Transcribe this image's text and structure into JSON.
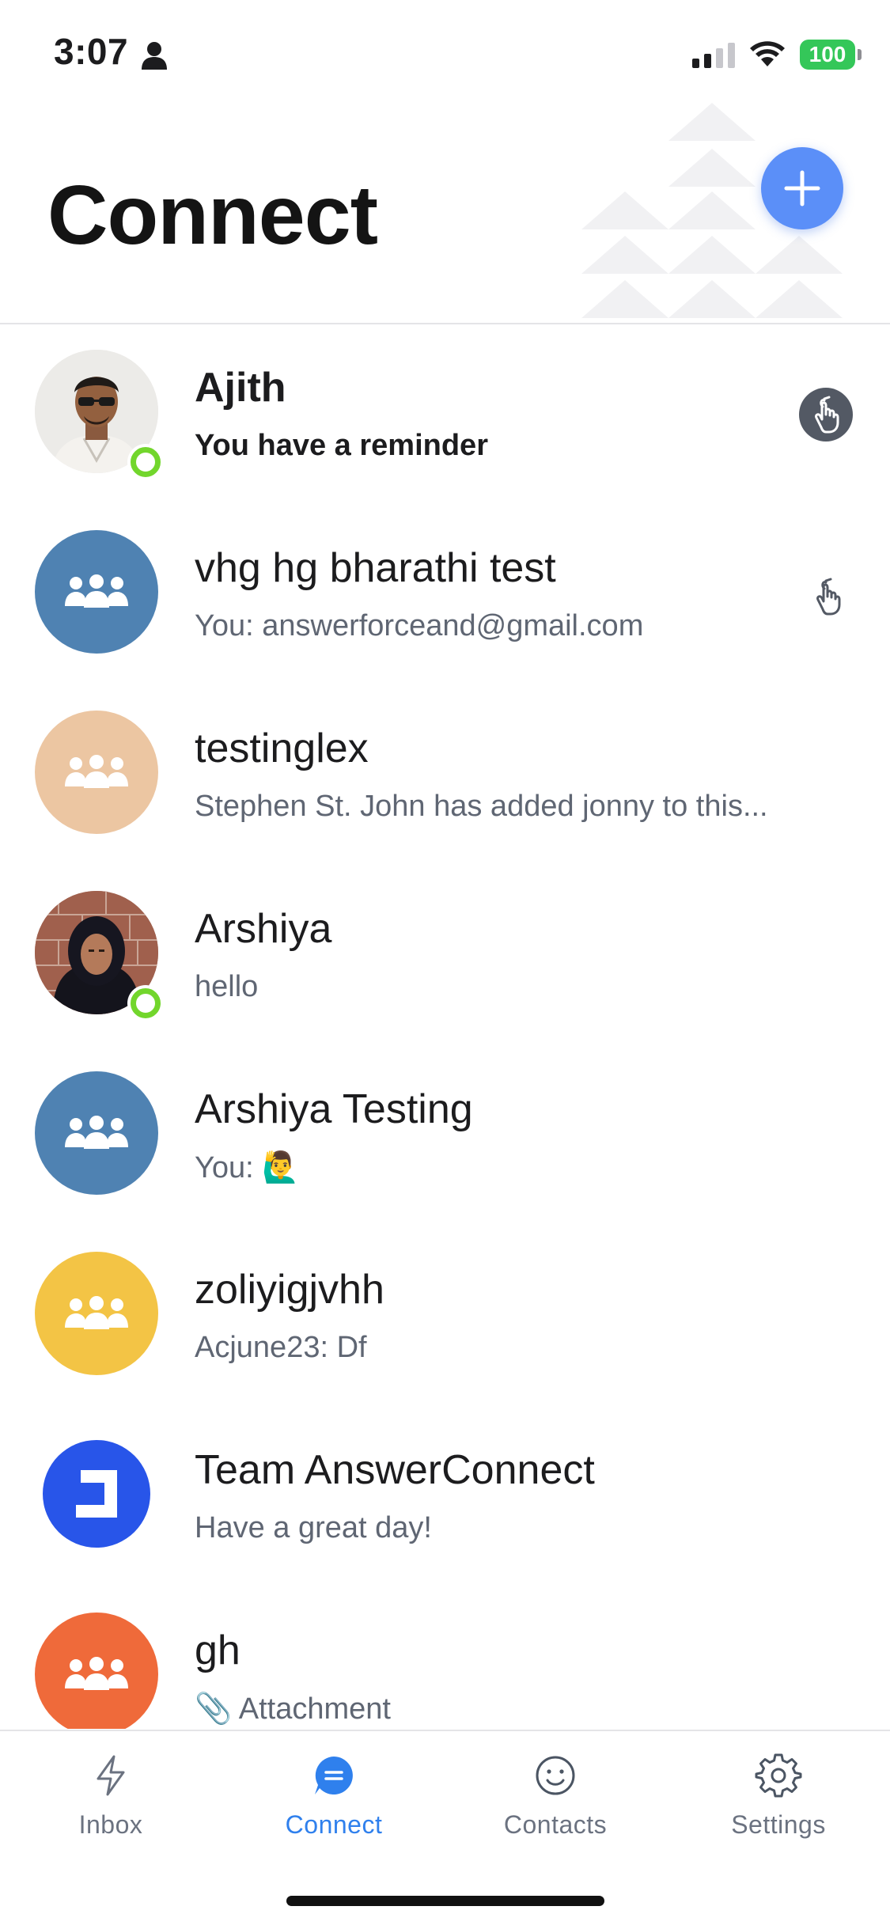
{
  "status_bar": {
    "time": "3:07",
    "battery": "100"
  },
  "header": {
    "title": "Connect"
  },
  "conversations": [
    {
      "name": "Ajith",
      "preview": "You have a reminder"
    },
    {
      "name": "vhg hg bharathi test",
      "preview": "You: answerforceand@gmail.com"
    },
    {
      "name": "testinglex",
      "preview": "Stephen St. John has added jonny to this..."
    },
    {
      "name": "Arshiya",
      "preview": "hello"
    },
    {
      "name": "Arshiya Testing",
      "preview": "You: 🙋‍♂️"
    },
    {
      "name": "zoliyigjvhh",
      "preview": "Acjune23: Df"
    },
    {
      "name": "Team AnswerConnect",
      "preview": "Have a great day!"
    },
    {
      "name": "gh",
      "preview": "📎 Attachment"
    }
  ],
  "tabs": [
    {
      "label": "Inbox",
      "icon": "lightning-icon"
    },
    {
      "label": "Connect",
      "icon": "chat-bubble-icon"
    },
    {
      "label": "Contacts",
      "icon": "smiley-icon"
    },
    {
      "label": "Settings",
      "icon": "gear-icon"
    }
  ],
  "colors": {
    "accent": "#2f80ed",
    "fab": "#5b8ff8",
    "online": "#72d62c",
    "group_blue": "#4f82b2",
    "group_peach": "#ecc6a2",
    "group_yellow": "#f3c445",
    "group_orange": "#ef6a3a",
    "brand_blue": "#2855e9"
  }
}
